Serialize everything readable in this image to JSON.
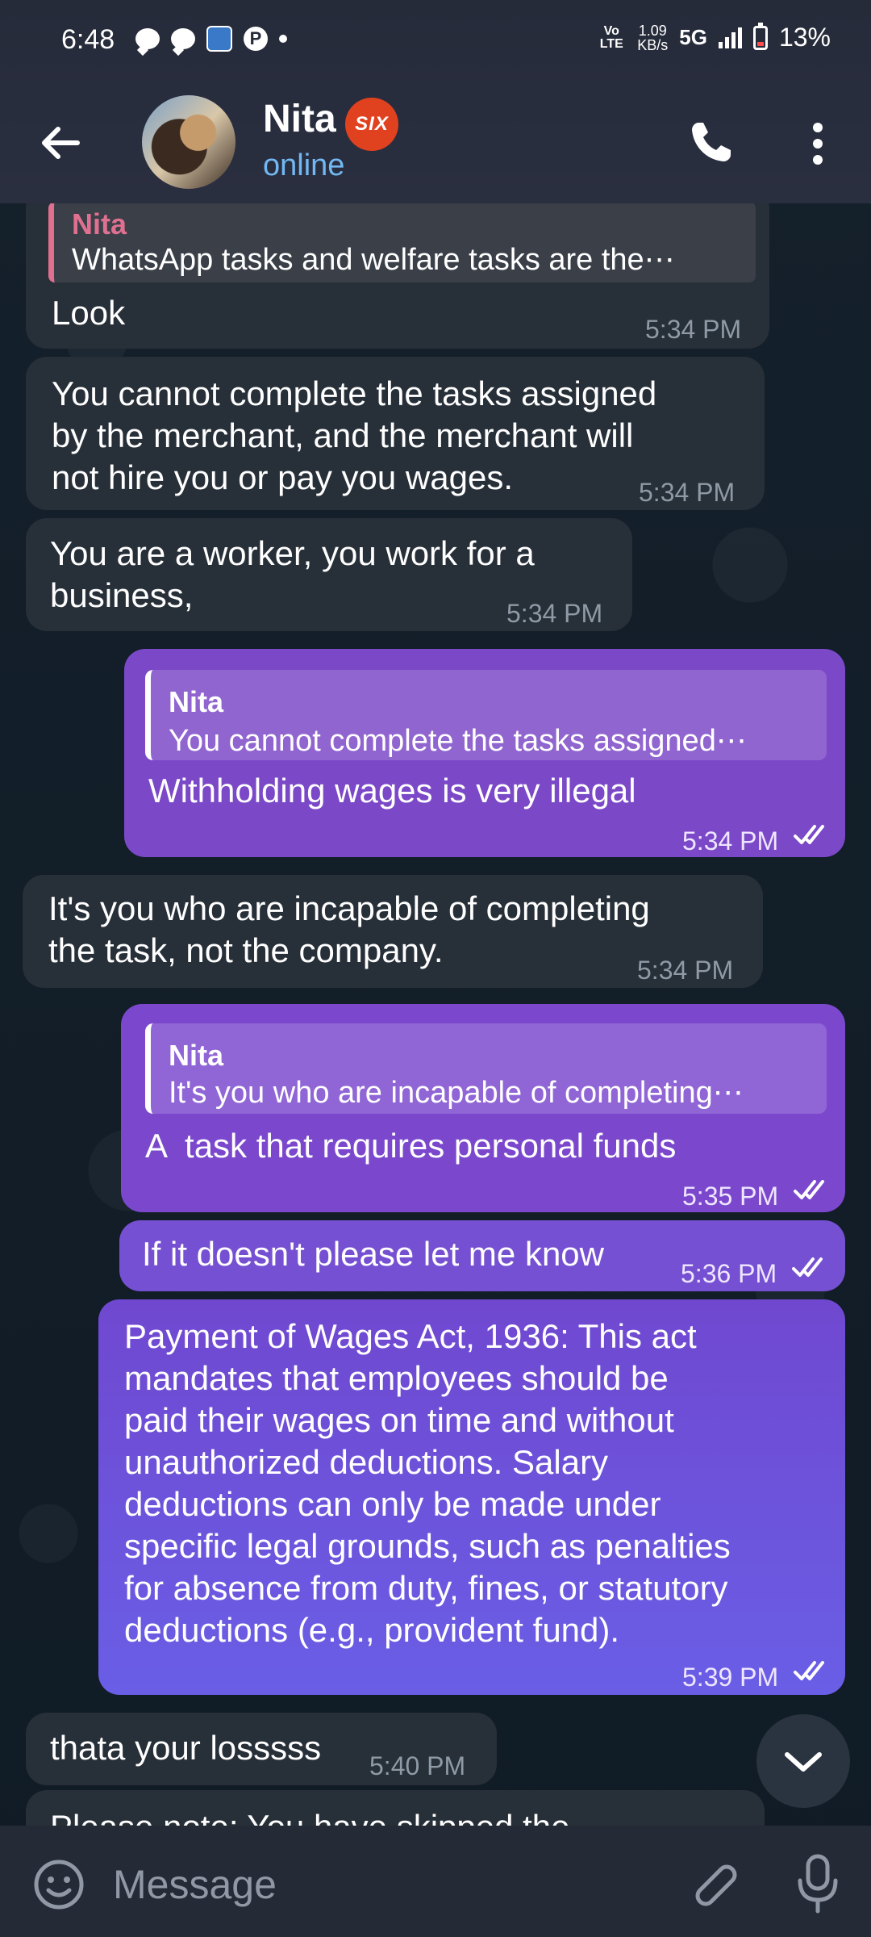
{
  "status_bar": {
    "time": "6:48",
    "volte": "Vo LTE",
    "speed_value": "1.09",
    "speed_unit": "KB/s",
    "network": "5G",
    "battery": "13%"
  },
  "header": {
    "contact_name": "Nita",
    "badge_text": "SIX",
    "status": "online"
  },
  "messages": [
    {
      "direction": "in",
      "reply_to_name": "Nita",
      "reply_to_text": "WhatsApp tasks and welfare tasks are the⋯",
      "text": "Look",
      "time": "5:34 PM"
    },
    {
      "direction": "in",
      "text": "You cannot complete the tasks assigned by the merchant, and the merchant will not hire you or pay you wages.",
      "lines": [
        "You cannot complete the tasks assigned",
        "by the merchant, and the merchant will",
        "not hire you or pay you wages."
      ],
      "time": "5:34 PM"
    },
    {
      "direction": "in",
      "text": "You are a worker, you work for a business,",
      "lines": [
        "You are a worker, you work for a",
        "business,"
      ],
      "time": "5:34 PM"
    },
    {
      "direction": "out",
      "reply_to_name": "Nita",
      "reply_to_text": "You cannot complete the tasks assigned⋯",
      "text": "Withholding wages is very illegal",
      "time": "5:34 PM",
      "read": true
    },
    {
      "direction": "in",
      "text": "It's you who are incapable of completing the task, not the company.",
      "lines": [
        "It's you who are incapable of completing",
        "the task, not the company."
      ],
      "time": "5:34 PM"
    },
    {
      "direction": "out",
      "reply_to_name": "Nita",
      "reply_to_text": "It's you who are incapable of completing⋯",
      "text": "A  task that requires personal funds",
      "time": "5:35 PM",
      "read": true
    },
    {
      "direction": "out",
      "text": "If it doesn't please let me know",
      "time": "5:36 PM",
      "read": true
    },
    {
      "direction": "out",
      "text": "Payment of Wages Act, 1936: This act mandates that employees should be paid their wages on time and without unauthorized deductions. Salary deductions can only be made under specific legal grounds, such as penalties for absence from duty, fines, or statutory deductions (e.g., provident fund).",
      "lines": [
        "Payment of Wages Act, 1936: This act",
        "mandates that employees should be",
        "paid their wages on time and without",
        "unauthorized deductions. Salary",
        "deductions can only be made under",
        "specific legal grounds, such as penalties",
        "for absence from duty, fines, or statutory",
        "deductions (e.g., provident fund)."
      ],
      "time": "5:39 PM",
      "read": true
    },
    {
      "direction": "in",
      "text": "thata your losssss",
      "time": "5:40 PM"
    },
    {
      "direction": "in",
      "text": "Please note: You have skipped the",
      "partial": true
    }
  ],
  "composer": {
    "placeholder": "Message"
  },
  "icons": {
    "back": "arrow-left-icon",
    "call": "phone-icon",
    "more": "more-vertical-icon",
    "emoji": "smile-icon",
    "attach": "paperclip-icon",
    "mic": "microphone-icon",
    "scroll_down": "chevron-down-icon",
    "read_receipt": "double-check-icon"
  },
  "colors": {
    "incoming_bubble": "#272f38",
    "outgoing_bubble": "#7a47c6",
    "online_status": "#72b8f2",
    "badge": "#e0411f",
    "quote_accent_in": "#e07090"
  }
}
